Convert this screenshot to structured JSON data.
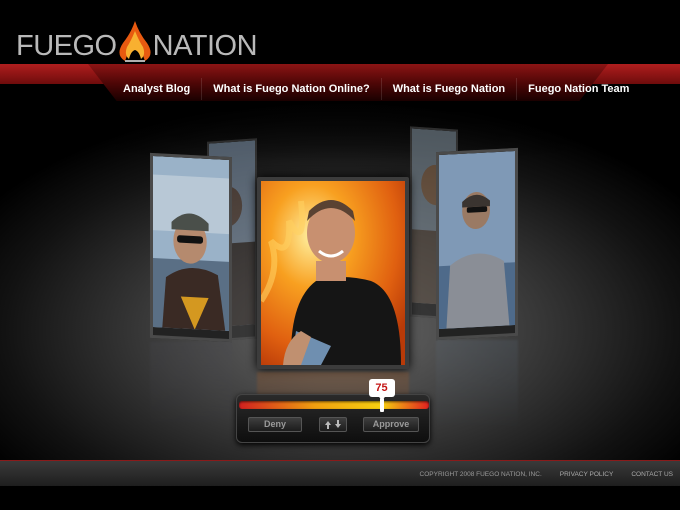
{
  "header": {
    "logo_left": "FUEGO",
    "logo_right": "NATION"
  },
  "nav": {
    "items": [
      {
        "label": "Analyst Blog"
      },
      {
        "label": "What is Fuego Nation Online?"
      },
      {
        "label": "What is Fuego Nation"
      },
      {
        "label": "Fuego Nation Team"
      }
    ]
  },
  "vote": {
    "score": "75",
    "level_percent": 75,
    "deny_label": "Deny",
    "approve_label": "Approve",
    "swap_icon": "up-down-arrows-icon"
  },
  "footer": {
    "copyright": "COPYRIGHT 2008 FUEGO NATION, INC.",
    "privacy": "PRIVACY POLICY",
    "contact": "CONTACT US"
  },
  "colors": {
    "brand_red": "#b01e1e",
    "flame_orange": "#f07010",
    "score_red": "#c41414"
  }
}
